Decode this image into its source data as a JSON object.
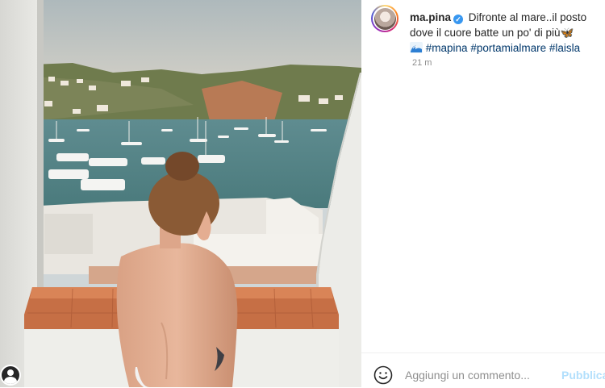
{
  "post": {
    "username": "ma.pina",
    "verified": true,
    "caption_line1": "Difronte al mare..il posto",
    "caption_line2": "dove il cuore batte un po' di più",
    "emoji_butterfly": "🦋",
    "hashtags": [
      "#mapina",
      "#portamialmare",
      "#laisla"
    ],
    "timestamp": "21 m"
  },
  "comment": {
    "placeholder": "Aggiungi un commento...",
    "post_label": "Pubblica"
  },
  "colors": {
    "link": "#00376b",
    "verified": "#3897f0",
    "post_disabled": "#b2dffc"
  },
  "icons": [
    "user-tag-icon",
    "verified-badge-icon",
    "emoji-smiley-icon",
    "wave-emoji-icon"
  ]
}
